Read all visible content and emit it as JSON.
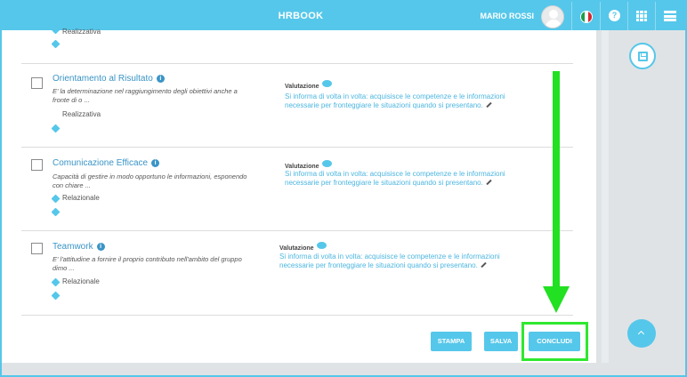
{
  "header": {
    "title": "HRBOOK",
    "user_name": "MARIO ROSSI",
    "help_glyph": "?",
    "colors": {
      "primary": "#55c7ea",
      "link": "#3a94c6",
      "highlight": "#2ee82e"
    },
    "icons": [
      "avatar-icon",
      "italy-flag-icon",
      "help-icon",
      "apps-grid-icon",
      "menu-icon"
    ]
  },
  "partial_item": {
    "category": "Realizzativa"
  },
  "items": [
    {
      "title": "Orientamento al Risultato",
      "description": "E' la determinazione nel raggiungimento degli obiettivi anche a fronte di o ...",
      "category": "Realizzativa",
      "valutazione_label": "Valutazione",
      "valutazione_text": "Si informa di volta in volta: acquisisce le competenze e le informazioni necessarie per fronteggiare le situazioni quando si presentano."
    },
    {
      "title": "Comunicazione Efficace",
      "description": "Capacità di gestire in modo opportuno le informazioni, esponendo con chiare ...",
      "category": "Relazionale",
      "valutazione_label": "Valutazione",
      "valutazione_text": "Si informa di volta in volta: acquisisce le competenze e le informazioni necessarie per fronteggiare le situazioni quando si presentano."
    },
    {
      "title": "Teamwork",
      "description": "E' l'attitudine a fornire il proprio contributo nell'ambito del gruppo dimo ...",
      "category": "Relazionale",
      "valutazione_label": "Valutazione",
      "valutazione_text": "Si informa di volta in volta: acquisisce le competenze e le informazioni necessarie per fronteggiare le situazioni quando si presentano."
    }
  ],
  "actions": {
    "stampa": "STAMPA",
    "salva": "SALVA",
    "concludi": "CONCLUDI"
  }
}
